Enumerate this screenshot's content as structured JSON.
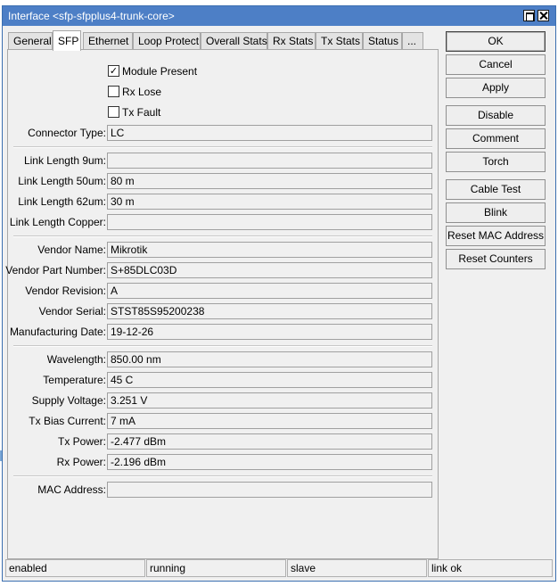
{
  "window": {
    "title": "Interface <sfp-sfpplus4-trunk-core>"
  },
  "tabs": [
    "General",
    "SFP",
    "Ethernet",
    "Loop Protect",
    "Overall Stats",
    "Rx Stats",
    "Tx Stats",
    "Status",
    "..."
  ],
  "active_tab": "SFP",
  "checkboxes": [
    {
      "label": "Module Present",
      "checked": true,
      "mark": "✓"
    },
    {
      "label": "Rx Lose",
      "checked": false,
      "mark": ""
    },
    {
      "label": "Tx Fault",
      "checked": false,
      "mark": ""
    }
  ],
  "fields": {
    "connector_type": {
      "label": "Connector Type:",
      "value": "LC"
    },
    "link_length_9um": {
      "label": "Link Length 9um:",
      "value": ""
    },
    "link_length_50um": {
      "label": "Link Length 50um:",
      "value": "80 m"
    },
    "link_length_62um": {
      "label": "Link Length 62um:",
      "value": "30 m"
    },
    "link_length_copper": {
      "label": "Link Length Copper:",
      "value": ""
    },
    "vendor_name": {
      "label": "Vendor Name:",
      "value": "Mikrotik"
    },
    "vendor_part_number": {
      "label": "Vendor Part Number:",
      "value": "S+85DLC03D"
    },
    "vendor_revision": {
      "label": "Vendor Revision:",
      "value": "A"
    },
    "vendor_serial": {
      "label": "Vendor Serial:",
      "value": "STST85S95200238"
    },
    "manufacturing_date": {
      "label": "Manufacturing Date:",
      "value": "19-12-26"
    },
    "wavelength": {
      "label": "Wavelength:",
      "value": "850.00 nm"
    },
    "temperature": {
      "label": "Temperature:",
      "value": "45 C"
    },
    "supply_voltage": {
      "label": "Supply Voltage:",
      "value": "3.251 V"
    },
    "tx_bias_current": {
      "label": "Tx Bias Current:",
      "value": "7 mA"
    },
    "tx_power": {
      "label": "Tx Power:",
      "value": "-2.477 dBm"
    },
    "rx_power": {
      "label": "Rx Power:",
      "value": "-2.196 dBm"
    },
    "mac_address": {
      "label": "MAC Address:",
      "value": ""
    }
  },
  "buttons": {
    "ok": "OK",
    "cancel": "Cancel",
    "apply": "Apply",
    "disable": "Disable",
    "comment": "Comment",
    "torch": "Torch",
    "cable_test": "Cable Test",
    "blink": "Blink",
    "reset_mac": "Reset MAC Address",
    "reset_counters": "Reset Counters"
  },
  "status_bar": [
    "enabled",
    "running",
    "slave",
    "link ok"
  ]
}
